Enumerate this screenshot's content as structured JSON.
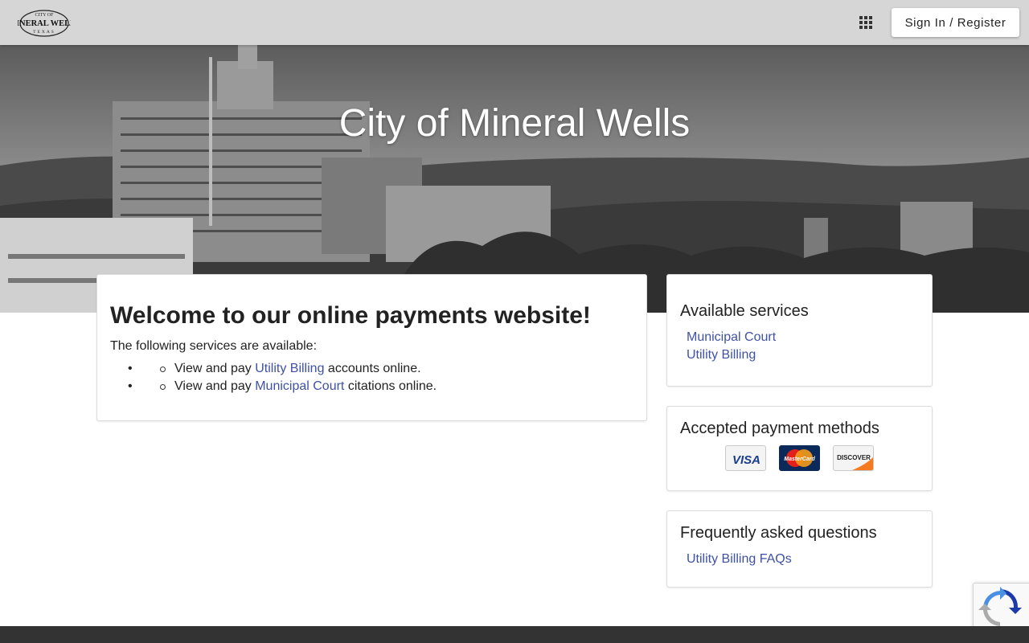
{
  "header": {
    "logo": {
      "alt": "City of Mineral Wells Texas",
      "line1": "CITY OF",
      "line2": "MINERAL WELLS",
      "line3": "TEXAS"
    },
    "apps_icon": "apps-grid-icon",
    "signin_label": "Sign In / Register"
  },
  "hero": {
    "title": "City of Mineral Wells"
  },
  "welcome": {
    "heading": "Welcome to our online payments website!",
    "intro": "The following services are available:",
    "items": [
      {
        "prefix": "View and pay ",
        "link": "Utility Billing",
        "suffix": " accounts online."
      },
      {
        "prefix": "View and pay ",
        "link": "Municipal Court",
        "suffix": " citations online."
      }
    ]
  },
  "services": {
    "heading": "Available services",
    "links": [
      "Municipal Court",
      "Utility Billing"
    ]
  },
  "payments": {
    "heading": "Accepted payment methods",
    "methods": [
      {
        "name": "VISA",
        "icon": "visa-card-icon"
      },
      {
        "name": "MasterCard",
        "icon": "mastercard-icon"
      },
      {
        "name": "DISCOVER",
        "icon": "discover-card-icon"
      }
    ]
  },
  "faq": {
    "heading": "Frequently asked questions",
    "links": [
      "Utility Billing FAQs"
    ]
  },
  "recaptcha": {
    "icon": "recaptcha-icon"
  },
  "colors": {
    "link": "#3f51a5",
    "topbar": "#d6d6d6",
    "footer": "#333333"
  }
}
